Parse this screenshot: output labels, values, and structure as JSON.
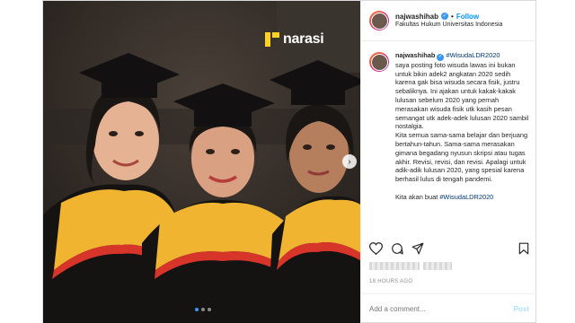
{
  "photo": {
    "watermark": "narasi",
    "carousel": {
      "dots": 3,
      "active_index": 0
    }
  },
  "header": {
    "username": "najwashihab",
    "follow_label": "Follow",
    "separator": "•",
    "location": "Fakultas Hukum Universitas Indonesia"
  },
  "caption": {
    "username": "najwashihab",
    "hashtag": "#WisudaLDR2020",
    "p1": "saya posting foto wisuda lawas ini bukan untuk bikin adek2 angkatan 2020 sedih karena gak bisa wisuda secara fisik, justru sebaliknya. Ini ajakan untuk kakak-kakak lulusan sebelum 2020 yang pernah merasakan wisuda fisik utk kasih pesan semangat utk adek-adek lulusan 2020 sambil nostalgia.",
    "p2": "Kita semua sama-sama belajar dan berjuang bertahun-tahun. Sama-sama merasakan gimana begadang nyusun skripsi atau tugas akhir. Revisi, revisi, dan revisi. Apalagi untuk adik-adik lulusan 2020, yang spesial karena berhasil lulus di tengah pandemi.",
    "p3_prefix": "Kita akan buat ",
    "p3_hashtag": "#WisudaLDR2020"
  },
  "actions": {
    "like": "heart-icon",
    "comment": "comment-icon",
    "share": "share-icon",
    "save": "bookmark-icon"
  },
  "timestamp": "18 HOURS AGO",
  "comment": {
    "placeholder": "Add a comment...",
    "post_label": "Post"
  },
  "colors": {
    "accent": "#0095f6",
    "hashtag": "#00376b",
    "watermark_mark": "#ffd21f",
    "gown": "#f0b431",
    "gown_trim": "#d8352a"
  }
}
